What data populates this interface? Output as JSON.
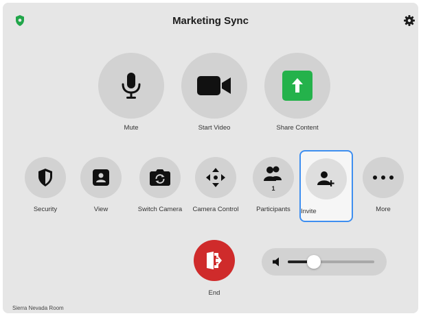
{
  "header": {
    "title": "Marketing Sync",
    "security_icon": "shield-icon",
    "settings_icon": "gear-icon"
  },
  "main_actions": [
    {
      "label": "Mute",
      "icon": "microphone-icon"
    },
    {
      "label": "Start Video",
      "icon": "video-camera-icon"
    },
    {
      "label": "Share Content",
      "icon": "share-arrow-icon",
      "accent": "#24b24b"
    }
  ],
  "toolbar": [
    {
      "label": "Security",
      "icon": "shield-icon"
    },
    {
      "label": "View",
      "icon": "view-person-icon"
    },
    {
      "label": "Switch Camera",
      "icon": "camera-switch-icon"
    },
    {
      "label": "Camera Control",
      "icon": "directional-arrows-icon"
    },
    {
      "label": "Participants",
      "icon": "people-icon",
      "count": "1"
    },
    {
      "label": "Invite",
      "icon": "add-person-icon",
      "selected": true
    },
    {
      "label": "More",
      "icon": "ellipsis-icon"
    }
  ],
  "end_call": {
    "label": "End",
    "icon": "exit-door-icon",
    "color": "#cf2b2b"
  },
  "volume": {
    "level": 0.3,
    "icon": "speaker-icon"
  },
  "room_name": "Sierra Nevada Room",
  "colors": {
    "background": "#e6e6e6",
    "button": "#d2d2d2",
    "selection": "#3d8ef0"
  }
}
